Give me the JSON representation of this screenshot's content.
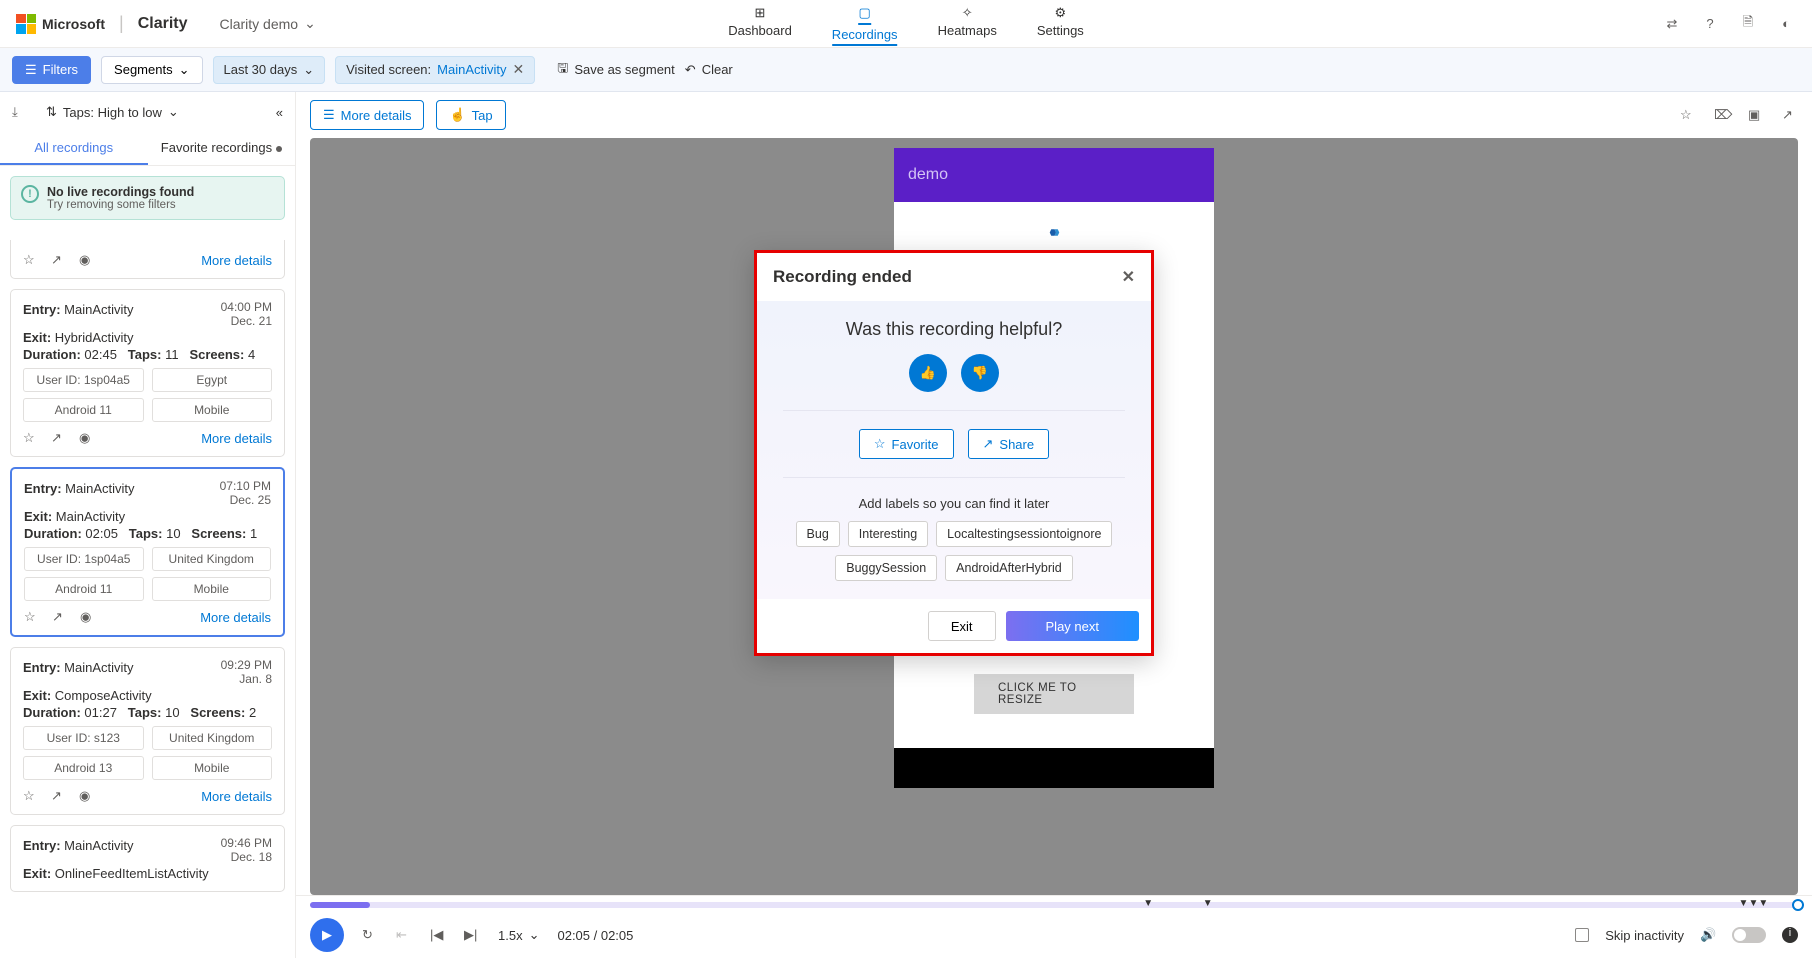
{
  "header": {
    "brand": "Microsoft",
    "app": "Clarity",
    "project": "Clarity demo",
    "nav": {
      "dashboard": "Dashboard",
      "recordings": "Recordings",
      "heatmaps": "Heatmaps",
      "settings": "Settings"
    }
  },
  "filters": {
    "filters_btn": "Filters",
    "segments_btn": "Segments",
    "daterange": "Last 30 days",
    "chip_prefix": "Visited screen: ",
    "chip_value": "MainActivity",
    "save_segment": "Save as segment",
    "clear": "Clear"
  },
  "side": {
    "sort": "Taps: High to low",
    "tab_all": "All recordings",
    "tab_fav": "Favorite recordings",
    "notice_title": "No live recordings found",
    "notice_sub": "Try removing some filters",
    "more": "More details"
  },
  "cards": [
    {
      "entry": "MainActivity",
      "exit": "HybridActivity",
      "duration": "02:45",
      "taps": "11",
      "screens": "4",
      "time": "04:00 PM",
      "date": "Dec. 21",
      "user": "User ID: 1sp04a5",
      "country": "Egypt",
      "os": "Android 11",
      "device": "Mobile",
      "selected": false
    },
    {
      "entry": "MainActivity",
      "exit": "MainActivity",
      "duration": "02:05",
      "taps": "10",
      "screens": "1",
      "time": "07:10 PM",
      "date": "Dec. 25",
      "user": "User ID: 1sp04a5",
      "country": "United Kingdom",
      "os": "Android 11",
      "device": "Mobile",
      "selected": true
    },
    {
      "entry": "MainActivity",
      "exit": "ComposeActivity",
      "duration": "01:27",
      "taps": "10",
      "screens": "2",
      "time": "09:29 PM",
      "date": "Jan. 8",
      "user": "User ID: s123",
      "country": "United Kingdom",
      "os": "Android 13",
      "device": "Mobile",
      "selected": false
    },
    {
      "entry": "MainActivity",
      "exit": "OnlineFeedItemListActivity",
      "duration": "",
      "taps": "",
      "screens": "",
      "time": "09:46 PM",
      "date": "Dec. 18",
      "user": "",
      "country": "",
      "os": "",
      "device": "",
      "selected": false
    }
  ],
  "mainbar": {
    "more": "More details",
    "tap": "Tap"
  },
  "phone": {
    "title": "demo",
    "resize": "CLICK ME TO RESIZE"
  },
  "dialog": {
    "title": "Recording ended",
    "question": "Was this recording helpful?",
    "favorite": "Favorite",
    "share": "Share",
    "labels_title": "Add labels so you can find it later",
    "tags": [
      "Bug",
      "Interesting",
      "Localtestingsessiontoignore",
      "BuggySession",
      "AndroidAfterHybrid"
    ],
    "exit": "Exit",
    "play_next": "Play next"
  },
  "player": {
    "speed": "1.5x",
    "time": "02:05 / 02:05",
    "skip": "Skip inactivity"
  },
  "labels": {
    "entry": "Entry:",
    "exit": "Exit:",
    "duration": "Duration:",
    "taps": "Taps:",
    "screens": "Screens:"
  }
}
